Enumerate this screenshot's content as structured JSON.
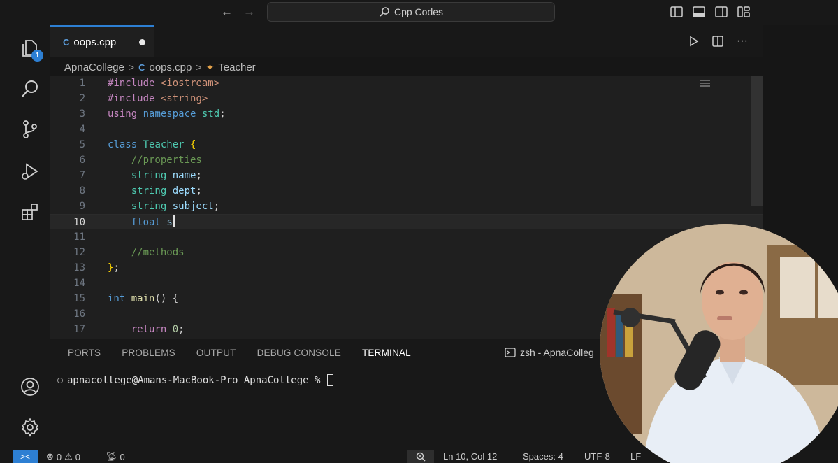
{
  "titlebar": {
    "back_arrow": "←",
    "forward_arrow": "→",
    "command_center": "Cpp Codes"
  },
  "activity_bar": {
    "explorer_badge": "1"
  },
  "tab": {
    "icon_label": "C",
    "filename": "oops.cpp"
  },
  "tab_actions": {
    "more": "···"
  },
  "breadcrumb": {
    "folder": "ApnaCollege",
    "file": "oops.cpp",
    "symbol": "Teacher",
    "separator": ">"
  },
  "editor": {
    "lines": [
      {
        "n": "1"
      },
      {
        "n": "2"
      },
      {
        "n": "3"
      },
      {
        "n": "4"
      },
      {
        "n": "5"
      },
      {
        "n": "6"
      },
      {
        "n": "7"
      },
      {
        "n": "8"
      },
      {
        "n": "9"
      },
      {
        "n": "10"
      },
      {
        "n": "11"
      },
      {
        "n": "12"
      },
      {
        "n": "13"
      },
      {
        "n": "14"
      },
      {
        "n": "15"
      },
      {
        "n": "16"
      },
      {
        "n": "17"
      }
    ],
    "current_line": "10"
  },
  "panel": {
    "tabs": [
      "PORTS",
      "PROBLEMS",
      "OUTPUT",
      "DEBUG CONSOLE",
      "TERMINAL"
    ],
    "active_tab": "TERMINAL",
    "terminal_name": "zsh - ApnaColleg",
    "prompt": "apnacollege@Amans-MacBook-Pro ApnaCollege %"
  },
  "statusbar": {
    "remote": "><",
    "errors": "0",
    "warnings": "0",
    "ports": "0",
    "position": "Ln 10, Col 12",
    "spaces": "Spaces: 4",
    "encoding": "UTF-8",
    "eol": "LF"
  },
  "colors": {
    "accent": "#2d7fd3",
    "background": "#1f1f1f",
    "keyword": "#569cd6",
    "string": "#ce9178",
    "comment": "#6a9955"
  }
}
